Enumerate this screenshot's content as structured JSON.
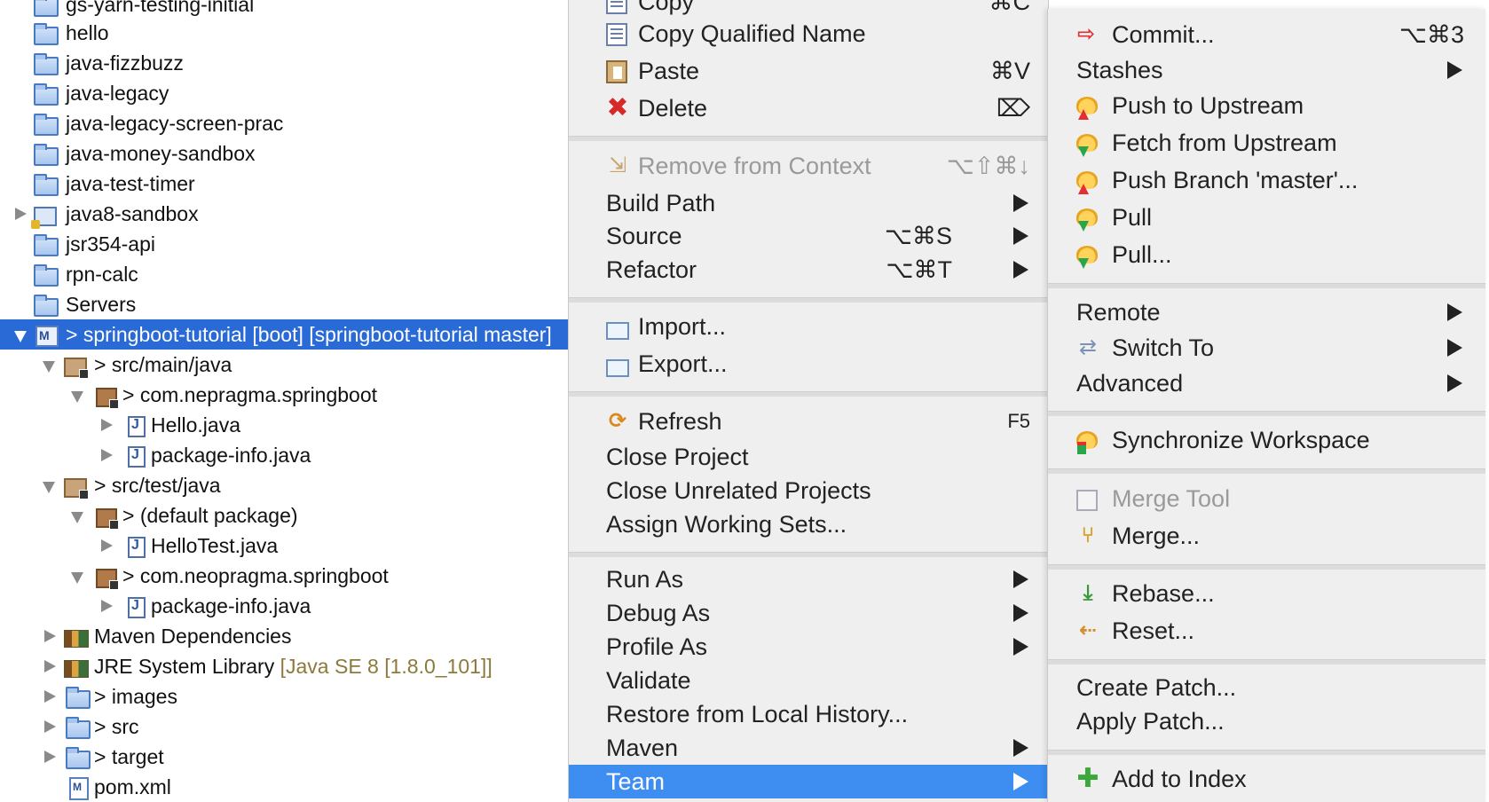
{
  "tree": {
    "rows": [
      {
        "label": "gs-yarn-testing-initial",
        "suffix": "",
        "icon": "folder-icon"
      },
      {
        "label": "hello",
        "suffix": "",
        "icon": "folder-icon"
      },
      {
        "label": "java-fizzbuzz",
        "suffix": "",
        "icon": "folder-icon"
      },
      {
        "label": "java-legacy",
        "suffix": "",
        "icon": "folder-icon"
      },
      {
        "label": "java-legacy-screen-prac",
        "suffix": "",
        "icon": "folder-icon"
      },
      {
        "label": "java-money-sandbox",
        "suffix": "",
        "icon": "folder-icon"
      },
      {
        "label": "java-test-timer",
        "suffix": "",
        "icon": "folder-icon"
      },
      {
        "label": "java8-sandbox",
        "suffix": "",
        "icon": "java-project-icon"
      },
      {
        "label": "jsr354-api",
        "suffix": "",
        "icon": "folder-icon"
      },
      {
        "label": "rpn-calc",
        "suffix": "",
        "icon": "folder-icon"
      },
      {
        "label": "Servers",
        "suffix": "",
        "icon": "folder-icon"
      },
      {
        "label": "> springboot-tutorial [boot] [springboot-tutorial master]",
        "suffix": "",
        "icon": "maven-project-icon"
      },
      {
        "label": "> src/main/java",
        "suffix": "",
        "icon": "source-folder-icon"
      },
      {
        "label": "> com.nepragma.springboot",
        "suffix": "",
        "icon": "package-icon"
      },
      {
        "label": "Hello.java",
        "suffix": "",
        "icon": "java-file-icon"
      },
      {
        "label": "package-info.java",
        "suffix": "",
        "icon": "java-file-icon"
      },
      {
        "label": "> src/test/java",
        "suffix": "",
        "icon": "source-folder-icon"
      },
      {
        "label": "> (default package)",
        "suffix": "",
        "icon": "package-icon"
      },
      {
        "label": "HelloTest.java",
        "suffix": "",
        "icon": "java-file-icon"
      },
      {
        "label": "> com.neopragma.springboot",
        "suffix": "",
        "icon": "package-icon"
      },
      {
        "label": "package-info.java",
        "suffix": "",
        "icon": "java-file-icon"
      },
      {
        "label": "Maven Dependencies",
        "suffix": "",
        "icon": "library-icon"
      },
      {
        "label": "JRE System Library ",
        "suffix": "[Java SE 8 [1.8.0_101]]",
        "icon": "library-icon"
      },
      {
        "label": "> images",
        "suffix": "",
        "icon": "folder-icon"
      },
      {
        "label": "> src",
        "suffix": "",
        "icon": "folder-icon"
      },
      {
        "label": "> target",
        "suffix": "",
        "icon": "folder-icon"
      },
      {
        "label": "pom.xml",
        "suffix": "",
        "icon": "pom-file-icon"
      }
    ]
  },
  "menu": {
    "items": {
      "copy": {
        "label": "Copy",
        "shortcut": "⌘C"
      },
      "copy_qualified": {
        "label": "Copy Qualified Name",
        "shortcut": ""
      },
      "paste": {
        "label": "Paste",
        "shortcut": "⌘V"
      },
      "delete": {
        "label": "Delete",
        "shortcut": "⌦"
      },
      "remove_context": {
        "label": "Remove from Context",
        "shortcut": "⌥⇧⌘↓"
      },
      "build_path": {
        "label": "Build Path",
        "shortcut": ""
      },
      "source": {
        "label": "Source",
        "shortcut": "⌥⌘S"
      },
      "refactor": {
        "label": "Refactor",
        "shortcut": "⌥⌘T"
      },
      "import": {
        "label": "Import...",
        "shortcut": ""
      },
      "export": {
        "label": "Export...",
        "shortcut": ""
      },
      "refresh": {
        "label": "Refresh",
        "shortcut": "F5"
      },
      "close_project": {
        "label": "Close Project",
        "shortcut": ""
      },
      "close_unrelated": {
        "label": "Close Unrelated Projects",
        "shortcut": ""
      },
      "assign_sets": {
        "label": "Assign Working Sets...",
        "shortcut": ""
      },
      "run_as": {
        "label": "Run As",
        "shortcut": ""
      },
      "debug_as": {
        "label": "Debug As",
        "shortcut": ""
      },
      "profile_as": {
        "label": "Profile As",
        "shortcut": ""
      },
      "validate": {
        "label": "Validate",
        "shortcut": ""
      },
      "restore_history": {
        "label": "Restore from Local History...",
        "shortcut": ""
      },
      "maven": {
        "label": "Maven",
        "shortcut": ""
      },
      "team": {
        "label": "Team",
        "shortcut": ""
      }
    }
  },
  "team_menu": {
    "items": {
      "commit": {
        "label": "Commit...",
        "shortcut": "⌥⌘3"
      },
      "stashes": {
        "label": "Stashes"
      },
      "push_upstream": {
        "label": "Push to Upstream"
      },
      "fetch_upstream": {
        "label": "Fetch from Upstream"
      },
      "push_branch": {
        "label": "Push Branch 'master'..."
      },
      "pull": {
        "label": "Pull"
      },
      "pull_dialog": {
        "label": "Pull..."
      },
      "remote": {
        "label": "Remote"
      },
      "switch_to": {
        "label": "Switch To"
      },
      "advanced": {
        "label": "Advanced"
      },
      "synchronize": {
        "label": "Synchronize Workspace"
      },
      "merge_tool": {
        "label": "Merge Tool"
      },
      "merge": {
        "label": "Merge..."
      },
      "rebase": {
        "label": "Rebase..."
      },
      "reset": {
        "label": "Reset..."
      },
      "create_patch": {
        "label": "Create Patch..."
      },
      "apply_patch": {
        "label": "Apply Patch..."
      },
      "add_index": {
        "label": "Add to Index"
      }
    }
  },
  "colors": {
    "selection": "#2a6ad6",
    "menu_highlight": "#3d8ef0",
    "menu_bg": "#efefef",
    "disabled": "#9a9a9a"
  }
}
